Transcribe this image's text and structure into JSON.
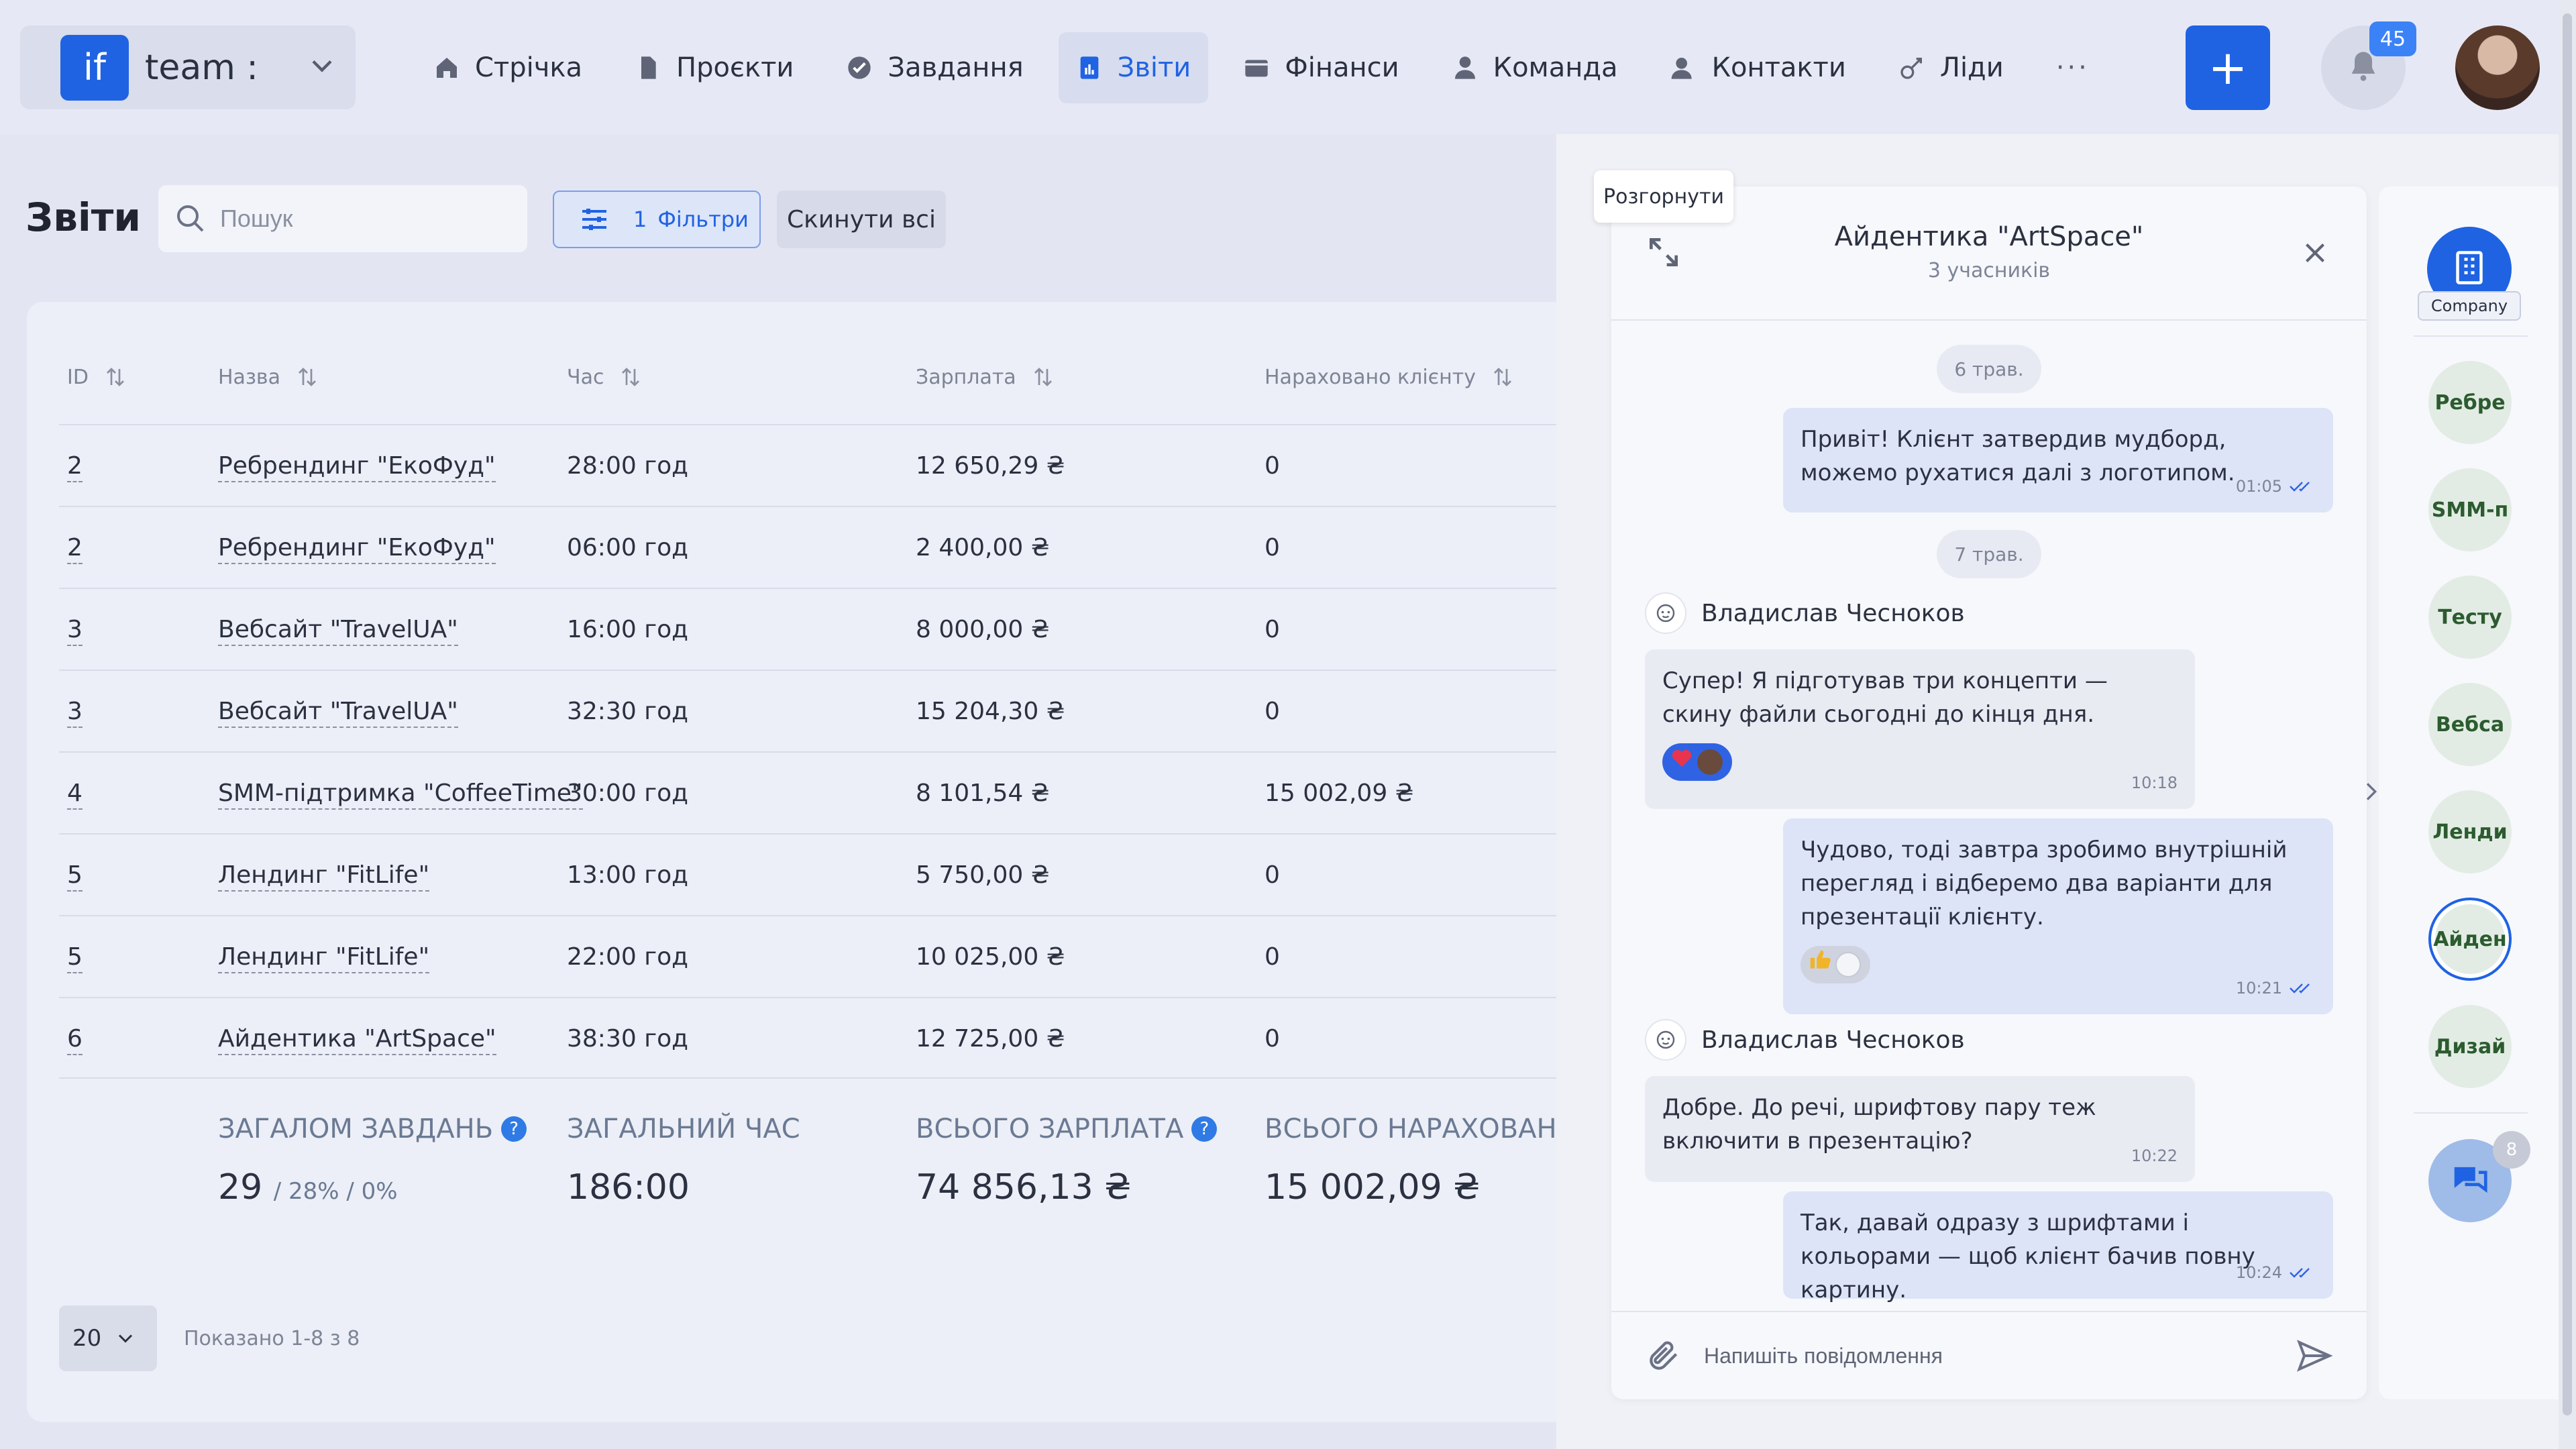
{
  "topbar": {
    "team_logo": "if",
    "team_name": "team :",
    "nav": [
      {
        "label": "Стрічка",
        "icon": "home-icon"
      },
      {
        "label": "Проєкти",
        "icon": "file-icon"
      },
      {
        "label": "Завдання",
        "icon": "check-circle-icon"
      },
      {
        "label": "Звіти",
        "icon": "report-icon",
        "active": true
      },
      {
        "label": "Фінанси",
        "icon": "wallet-icon"
      },
      {
        "label": "Команда",
        "icon": "user-icon"
      },
      {
        "label": "Контакти",
        "icon": "contacts-icon"
      },
      {
        "label": "Ліди",
        "icon": "leads-icon"
      }
    ],
    "more": "···",
    "plus": "+",
    "notifications": "45"
  },
  "page": {
    "title": "Звіти",
    "search_placeholder": "Пошук",
    "filters_count": "1",
    "filters_label": "Фільтри",
    "reset_label": "Скинути всі"
  },
  "table": {
    "headers": [
      "ID",
      "Назва",
      "Час",
      "Зарплата",
      "Нараховано клієнту"
    ],
    "rows": [
      {
        "id": "2",
        "name": "Ребрендинг \"ЕкоФуд\"",
        "time": "28:00 год",
        "salary": "12 650,29 ₴",
        "charged": "0"
      },
      {
        "id": "2",
        "name": "Ребрендинг \"ЕкоФуд\"",
        "time": "06:00 год",
        "salary": "2 400,00 ₴",
        "charged": "0"
      },
      {
        "id": "3",
        "name": "Вебсайт \"TravelUA\"",
        "time": "16:00 год",
        "salary": "8 000,00 ₴",
        "charged": "0"
      },
      {
        "id": "3",
        "name": "Вебсайт \"TravelUA\"",
        "time": "32:30 год",
        "salary": "15 204,30 ₴",
        "charged": "0"
      },
      {
        "id": "4",
        "name": "SMM-підтримка \"CoffeeTime\"",
        "time": "30:00 год",
        "salary": "8 101,54 ₴",
        "charged": "15 002,09 ₴"
      },
      {
        "id": "5",
        "name": "Лендинг \"FitLife\"",
        "time": "13:00 год",
        "salary": "5 750,00 ₴",
        "charged": "0"
      },
      {
        "id": "5",
        "name": "Лендинг \"FitLife\"",
        "time": "22:00 год",
        "salary": "10 025,00 ₴",
        "charged": "0"
      },
      {
        "id": "6",
        "name": "Айдентика \"ArtSpace\"",
        "time": "38:30 год",
        "salary": "12 725,00 ₴",
        "charged": "0"
      }
    ],
    "totals": {
      "tasks_label": "ЗАГАЛОМ ЗАВДАНЬ",
      "tasks_value": "29",
      "tasks_sub": "/ 28% / 0%",
      "time_label": "ЗАГАЛЬНИЙ ЧАС",
      "time_value": "186:00",
      "salary_label": "ВСЬОГО ЗАРПЛАТА",
      "salary_value": "74 856,13 ₴",
      "charged_label": "ВСЬОГО НАРАХОВАН...",
      "charged_value": "15 002,09 ₴",
      "help": "?"
    },
    "page_size": "20",
    "shown": "Показано 1-8 з 8"
  },
  "chat": {
    "tooltip": "Розгорнути",
    "title": "Айдентика \"ArtSpace\"",
    "subtitle": "3 учасників",
    "dates": [
      "6 трав.",
      "7 трав."
    ],
    "messages": [
      {
        "dir": "out",
        "text": "Привіт! Клієнт затвердив мудборд, можемо рухатися далі з логотипом.",
        "time": "01:05"
      },
      {
        "dir": "in",
        "sender": "Владислав Чесноков",
        "text": "Супер! Я підготував три концепти — скину файли сьогодні до кінця дня.",
        "time": "10:18"
      },
      {
        "dir": "out",
        "text": "Чудово, тоді завтра зробимо внутрішній перегляд і відберемо два варіанти для презентації клієнту.",
        "time": "10:21"
      },
      {
        "dir": "in",
        "sender": "Владислав Чесноков",
        "text": "Добре. До речі, шрифтову пару теж включити в презентацію?",
        "time": "10:22"
      },
      {
        "dir": "out",
        "text": "Так, давай одразу з шрифтами і кольорами — щоб клієнт бачив повну картину.",
        "time": "10:24"
      }
    ],
    "composer_placeholder": "Напишіть повідомлення"
  },
  "rail": {
    "company_label": "Company",
    "items": [
      "Ребре",
      "SMM-п",
      "Тесту",
      "Вебса",
      "Ленди",
      "Айден",
      "Дизай"
    ],
    "active_index": 5,
    "chat_badge": "8"
  },
  "colors": {
    "accent": "#1f63e3",
    "background": "#e3e6f2",
    "card": "#eceff7",
    "bubble_out": "#dde4f7",
    "bubble_in": "#e9ebf3"
  }
}
